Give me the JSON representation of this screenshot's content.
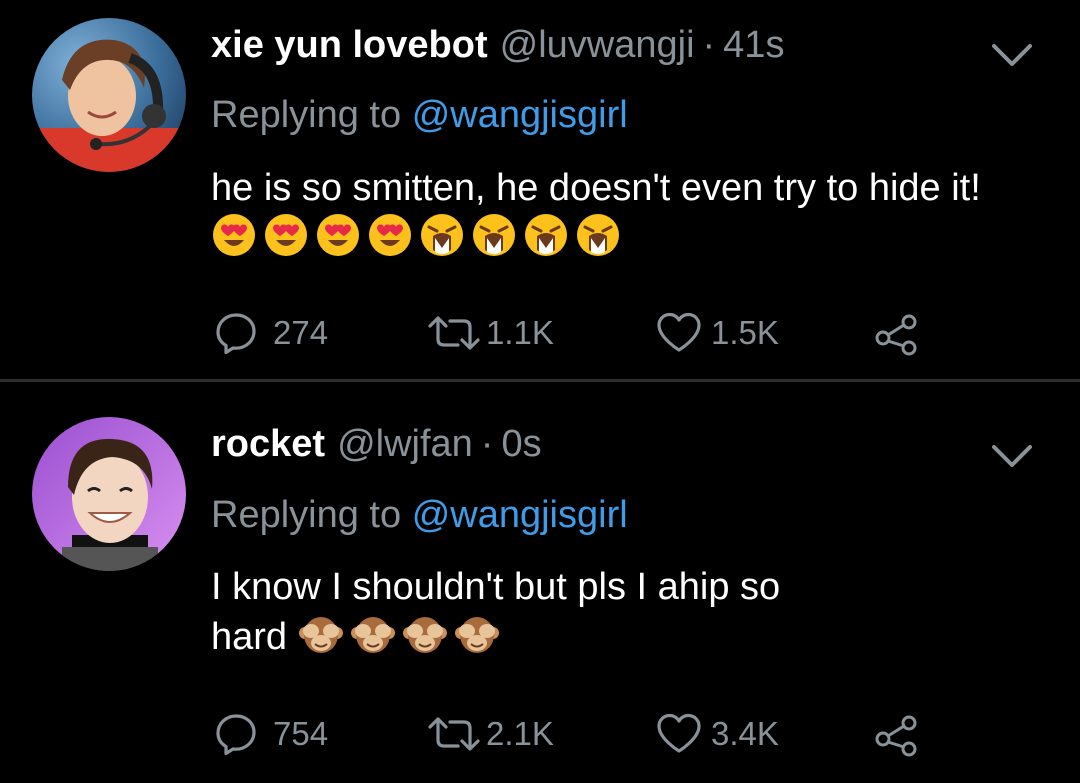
{
  "tweets": [
    {
      "display_name": "xie yun lovebot",
      "handle": "@luvwangji",
      "separator": "·",
      "time": "41s",
      "replying_prefix": "Replying to",
      "replying_to": "@wangjisgirl",
      "text": "he is so smitten, he doesn't even try to hide it!",
      "emoji_sequence": [
        "heart-eyes",
        "heart-eyes",
        "heart-eyes",
        "heart-eyes",
        "crying-loudly",
        "crying-loudly",
        "crying-loudly",
        "crying-loudly"
      ],
      "reply_count": "274",
      "retweet_count": "1.1K",
      "like_count": "1.5K"
    },
    {
      "display_name": "rocket",
      "handle": "@lwjfan",
      "separator": "·",
      "time": "0s",
      "replying_prefix": "Replying to",
      "replying_to": "@wangjisgirl",
      "text": "I know I shouldn't but pls I ahip so hard",
      "emoji_sequence": [
        "see-no-evil-monkey",
        "see-no-evil-monkey",
        "see-no-evil-monkey",
        "see-no-evil-monkey"
      ],
      "reply_count": "754",
      "retweet_count": "2.1K",
      "like_count": "3.4K"
    }
  ],
  "icons": {
    "reply": "speech-bubble-icon",
    "retweet": "retweet-icon",
    "like": "heart-icon",
    "share": "share-icon",
    "menu": "chevron-down-icon"
  },
  "colors": {
    "background": "#000000",
    "secondary_text": "#8a9299",
    "mention": "#3f9ce8",
    "divider": "#2b2b2b"
  }
}
